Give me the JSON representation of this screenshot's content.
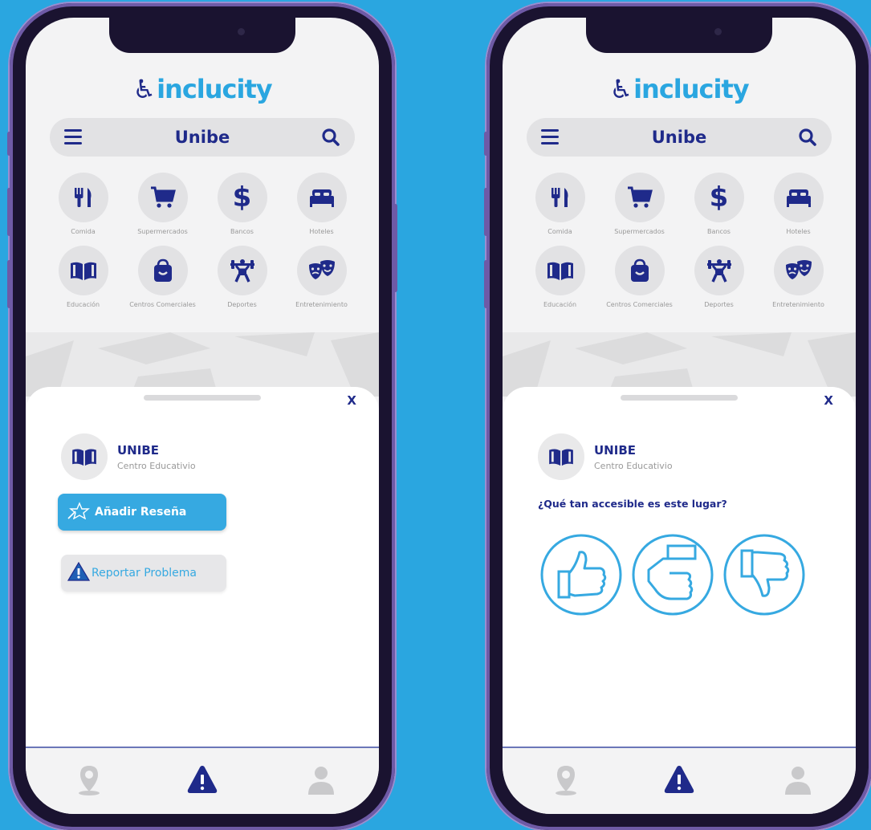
{
  "screens": [
    {
      "logo": "inclucity",
      "search_title": "Unibe",
      "categories": [
        "Comida",
        "Supermercados",
        "Bancos",
        "Hoteles",
        "Educación",
        "Centros Comerciales",
        "Deportes",
        "Entretenimiento"
      ],
      "sheet": {
        "close_label": "X",
        "place_name": "UNIBE",
        "place_type": "Centro Educativio",
        "review_button": "Añadir Reseña",
        "report_button": "Reportar Problema"
      }
    },
    {
      "logo": "inclucity",
      "search_title": "Unibe",
      "categories": [
        "Comida",
        "Supermercados",
        "Bancos",
        "Hoteles",
        "Educación",
        "Centros Comerciales",
        "Deportes",
        "Entretenimiento"
      ],
      "sheet": {
        "close_label": "X",
        "place_name": "UNIBE",
        "place_type": "Centro Educativio",
        "question": "¿Qué tan accesible es este lugar?",
        "rating_options": [
          "thumbs-up-icon",
          "thumbs-sideways-icon",
          "thumbs-down-icon"
        ]
      }
    }
  ],
  "colors": {
    "background": "#2aa6e0",
    "brand_dark": "#1f2a8a",
    "brand_light": "#36a9e1",
    "phone_frame": "#1a1330"
  },
  "bottom_nav": [
    "location-pin-icon",
    "warning-icon",
    "user-icon"
  ]
}
